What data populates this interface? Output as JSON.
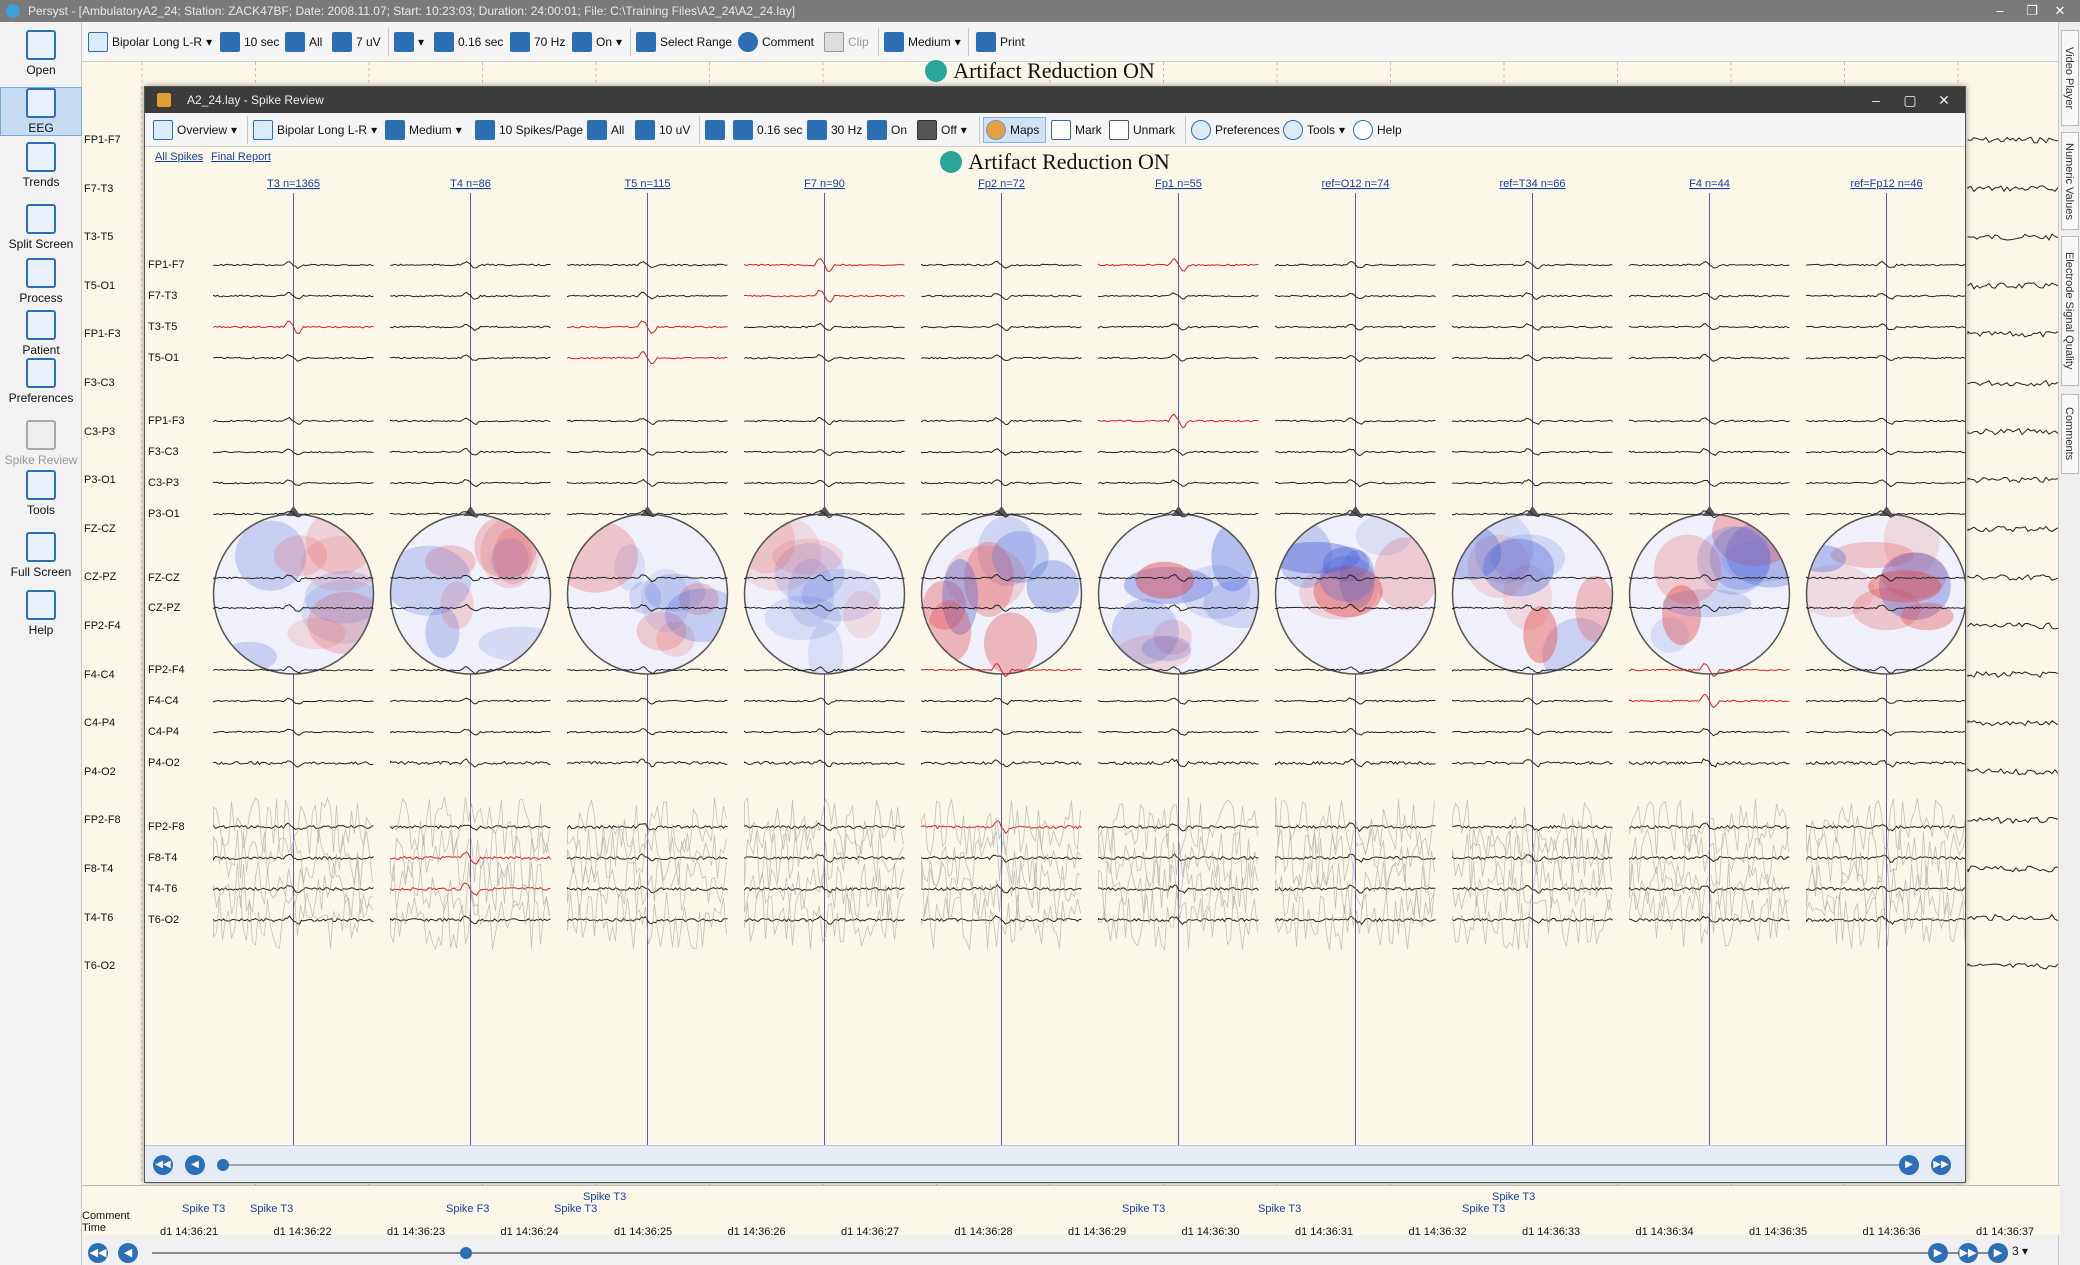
{
  "app": {
    "title": "Persyst - [AmbulatoryA2_24; Station: ZACK47BF; Date: 2008.11.07; Start: 10:23:03; Duration: 24:00:01; File: C:\\Training Files\\A2_24\\A2_24.lay]",
    "win_minimize": "–",
    "win_restore": "❐",
    "win_close": "✕"
  },
  "toolbar": {
    "montage": "Bipolar Long L-R",
    "timebase": "10 sec",
    "channels": "All",
    "sensitivity": "7 uV",
    "lff": "0.16 sec",
    "hff": "70 Hz",
    "notch": "On",
    "select_range": "Select Range",
    "comment": "Comment",
    "clip": "Clip",
    "layout": "Medium",
    "print": "Print"
  },
  "sidebar": [
    {
      "label": "Open",
      "icon": "folder-open-icon"
    },
    {
      "label": "EEG",
      "icon": "eeg-icon"
    },
    {
      "label": "Trends",
      "icon": "trends-icon"
    },
    {
      "label": "Split Screen",
      "icon": "split-screen-icon"
    },
    {
      "label": "Process",
      "icon": "play-icon"
    },
    {
      "label": "Patient",
      "icon": "patient-icon"
    },
    {
      "label": "Preferences",
      "icon": "gear-icon"
    },
    {
      "label": "Spike Review",
      "icon": "spike-review-icon"
    },
    {
      "label": "Tools",
      "icon": "tools-icon"
    },
    {
      "label": "Full Screen",
      "icon": "fullscreen-icon"
    },
    {
      "label": "Help",
      "icon": "help-icon"
    }
  ],
  "artifact_banner": "Artifact Reduction ON",
  "main_channels": [
    "FP1-F7",
    "F7-T3",
    "T3-T5",
    "T5-O1",
    "FP1-F3",
    "F3-C3",
    "C3-P3",
    "P3-O1",
    "FZ-CZ",
    "CZ-PZ",
    "FP2-F4",
    "F4-C4",
    "C4-P4",
    "P4-O2",
    "FP2-F8",
    "F8-T4",
    "T4-T6",
    "T6-O2"
  ],
  "right_tabs": [
    "Video Player",
    "Numeric Values",
    "Electrode Signal Quality",
    "Comments"
  ],
  "spike_window": {
    "title": "A2_24.lay - Spike Review",
    "toolbar": {
      "overview": "Overview",
      "montage": "Bipolar Long L-R",
      "layout": "Medium",
      "spikes_per_page": "10 Spikes/Page",
      "channels": "All",
      "sensitivity": "10 uV",
      "lff": "0.16 sec",
      "hff": "30 Hz",
      "notch": "On",
      "cf": "Off",
      "maps": "Maps",
      "mark": "Mark",
      "unmark": "Unmark",
      "preferences": "Preferences",
      "tools": "Tools",
      "help": "Help"
    },
    "links": {
      "all_spikes": "All Spikes",
      "final_report": "Final Report"
    },
    "artifact_banner": "Artifact Reduction ON",
    "spike_groups": [
      "T3 n=1365",
      "T4 n=86",
      "T5 n=115",
      "F7 n=90",
      "Fp2 n=72",
      "Fp1 n=55",
      "ref=O12 n=74",
      "ref=T34 n=66",
      "F4 n=44",
      "ref=Fp12 n=46"
    ],
    "channels": [
      "FP1-F7",
      "F7-T3",
      "T3-T5",
      "T5-O1",
      "FP1-F3",
      "F3-C3",
      "C3-P3",
      "P3-O1",
      "FZ-CZ",
      "CZ-PZ",
      "FP2-F4",
      "F4-C4",
      "C4-P4",
      "P4-O2",
      "FP2-F8",
      "F8-T4",
      "T4-T6",
      "T6-O2"
    ],
    "highlighted": [
      [
        2
      ],
      [
        15,
        16
      ],
      [
        2,
        3
      ],
      [
        0,
        1
      ],
      [
        10,
        14
      ],
      [
        0,
        4
      ],
      [],
      [],
      [
        10,
        11
      ],
      []
    ],
    "map_colors": {
      "red": "#e34a4a",
      "blue": "#4a64d8",
      "neutral": "#f0f0fa"
    }
  },
  "comments_row": {
    "label_comment": "Comment",
    "label_time": "Time",
    "spikes": [
      {
        "text": "Spike T3",
        "l": 0.0
      },
      {
        "text": "Spike T3",
        "l": 1
      },
      {
        "text": "Spike F3",
        "l": 2
      },
      {
        "text": "Spike T3",
        "l": 3
      },
      {
        "text": "Spike T3",
        "l": 4
      },
      {
        "text": "Spike T3",
        "l": 5
      },
      {
        "text": "Spike T3",
        "l": 6
      },
      {
        "text": "Spike T3",
        "l": 7
      },
      {
        "text": "Spike T3",
        "l": 8
      }
    ],
    "times": [
      "d1 14:36:21",
      "d1 14:36:22",
      "d1 14:36:23",
      "d1 14:36:24",
      "d1 14:36:25",
      "d1 14:36:26",
      "d1 14:36:27",
      "d1 14:36:28",
      "d1 14:36:29",
      "d1 14:36:30",
      "d1 14:36:31",
      "d1 14:36:32",
      "d1 14:36:33",
      "d1 14:36:34",
      "d1 14:36:35",
      "d1 14:36:36",
      "d1 14:36:37"
    ]
  },
  "page_select": "3"
}
